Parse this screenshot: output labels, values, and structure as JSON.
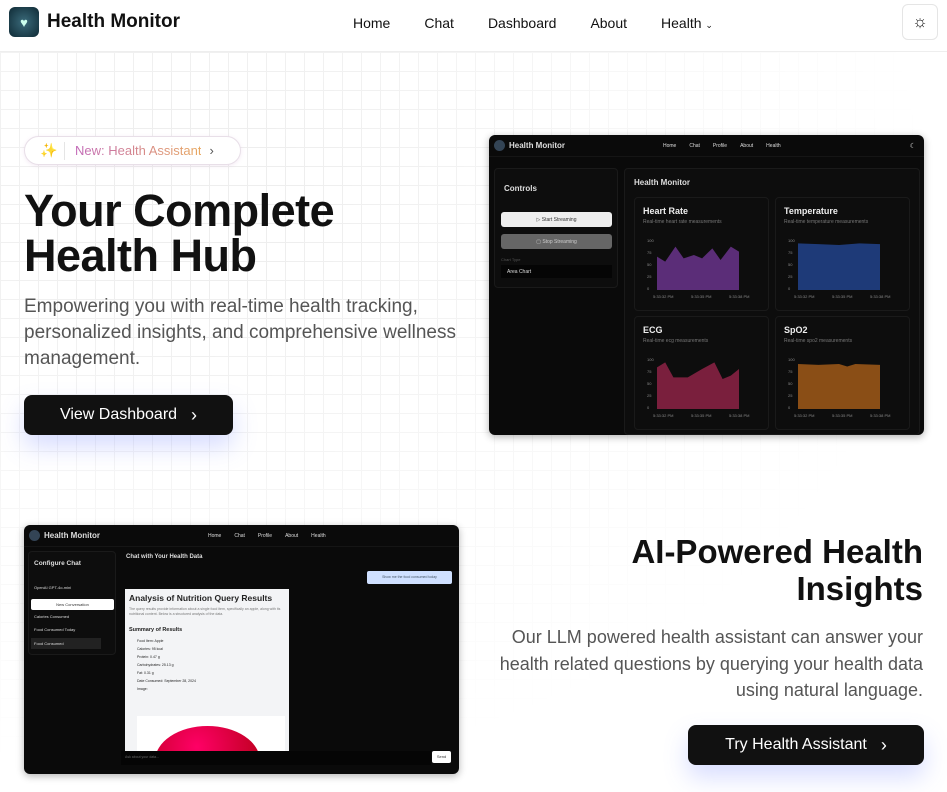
{
  "nav": {
    "brand": "Health Monitor",
    "links": [
      "Home",
      "Chat",
      "Dashboard",
      "About",
      "Health"
    ],
    "theme_icon": "sun-icon"
  },
  "hero": {
    "badge": "New: Health Assistant",
    "title": "Your Complete Health Hub",
    "subtitle": "Empowering you with real-time health tracking, personalized insights, and comprehensive wellness management.",
    "cta": "View Dashboard"
  },
  "dashboard_preview": {
    "brand": "Health Monitor",
    "links": [
      "Home",
      "Chat",
      "Profile",
      "About",
      "Health"
    ],
    "controls": "Controls",
    "start": "Start Streaming",
    "stop": "Stop Streaming",
    "chart_type_label": "Chart Type",
    "chart_type": "Area Chart",
    "title": "Health Monitor",
    "cards": [
      {
        "title": "Heart Rate",
        "sub": "Real-time heart rate measurements",
        "color": "#5b2d78"
      },
      {
        "title": "Temperature",
        "sub": "Real-time temperature measurements",
        "color": "#1e3a78"
      },
      {
        "title": "ECG",
        "sub": "Real-time ecg measurements",
        "color": "#7a1f3d"
      },
      {
        "title": "SpO2",
        "sub": "Real-time spo2 measurements",
        "color": "#8a4e16"
      }
    ],
    "yticks": [
      "100",
      "75",
      "50",
      "25",
      "0"
    ],
    "xticks": [
      "5:33:32 PM",
      "5:33:35 PM",
      "5:33:38 PM"
    ]
  },
  "chat_preview": {
    "brand": "Health Monitor",
    "links": [
      "Home",
      "Chat",
      "Profile",
      "About",
      "Health"
    ],
    "configure": "Configure Chat",
    "model": "OpenAI GPT-4o-mini",
    "new_conv": "New Conversation",
    "conversations": [
      "Calories Consumed",
      "Food Consumed Today",
      "Food Consumed"
    ],
    "title": "Chat with Your Health Data",
    "user_msg": "Show me the food consumed today",
    "resp_title": "Analysis of Nutrition Query Results",
    "resp_text": "The query results provide information about a single food item, specifically an apple, along with its nutritional content. Below is a structured analysis of the data.",
    "summary": "Summary of Results",
    "items": [
      "Food Item: Apple",
      "Calories: 95 kcal",
      "Protein: 0.47 g",
      "Carbohydrates: 25.13 g",
      "Fat: 0.31 g",
      "Date Consumed: September 28, 2024",
      "Image:"
    ],
    "input_placeholder": "Ask about your data...",
    "send": "Send"
  },
  "ai": {
    "title": "AI-Powered Health Insights",
    "subtitle": "Our LLM powered health assistant can answer your health related questions by querying your health data using natural language.",
    "cta": "Try Health Assistant"
  }
}
